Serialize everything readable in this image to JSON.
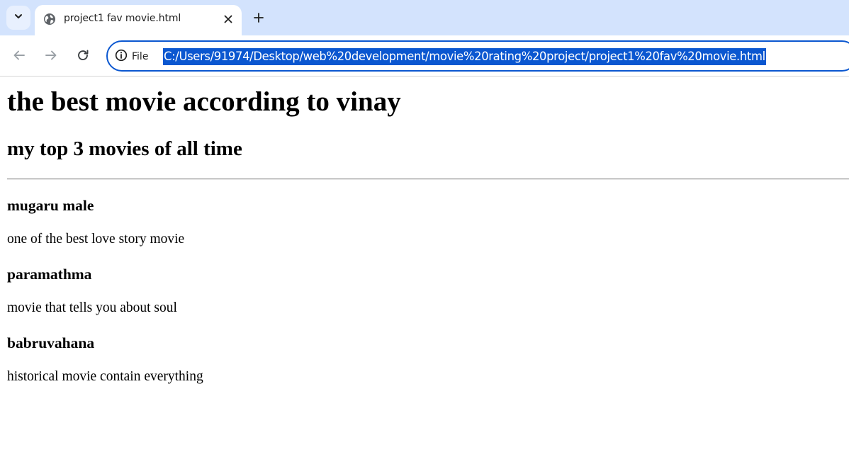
{
  "browser": {
    "tab": {
      "title": "project1 fav movie.html"
    },
    "address_bar": {
      "site_info_label": "File",
      "url": "C:/Users/91974/Desktop/web%20development/movie%20rating%20project/project1%20fav%20movie.html"
    },
    "icons": {
      "tab_menu": "chevron-down-icon",
      "favicon": "globe-icon",
      "tab_close": "close-icon",
      "new_tab": "plus-icon",
      "back": "back-arrow-icon",
      "forward": "forward-arrow-icon",
      "reload": "reload-icon",
      "site_info": "info-icon"
    },
    "colors": {
      "tabstrip": "#d3e3fd",
      "accent": "#0b57d0"
    }
  },
  "page": {
    "heading": "the best movie according to vinay",
    "subheading": "my top 3 movies of all time",
    "movies": [
      {
        "title": "mugaru male",
        "description": "one of the best love story movie"
      },
      {
        "title": "paramathma",
        "description": "movie that tells you about soul"
      },
      {
        "title": "babruvahana",
        "description": "historical movie contain everything"
      }
    ]
  }
}
